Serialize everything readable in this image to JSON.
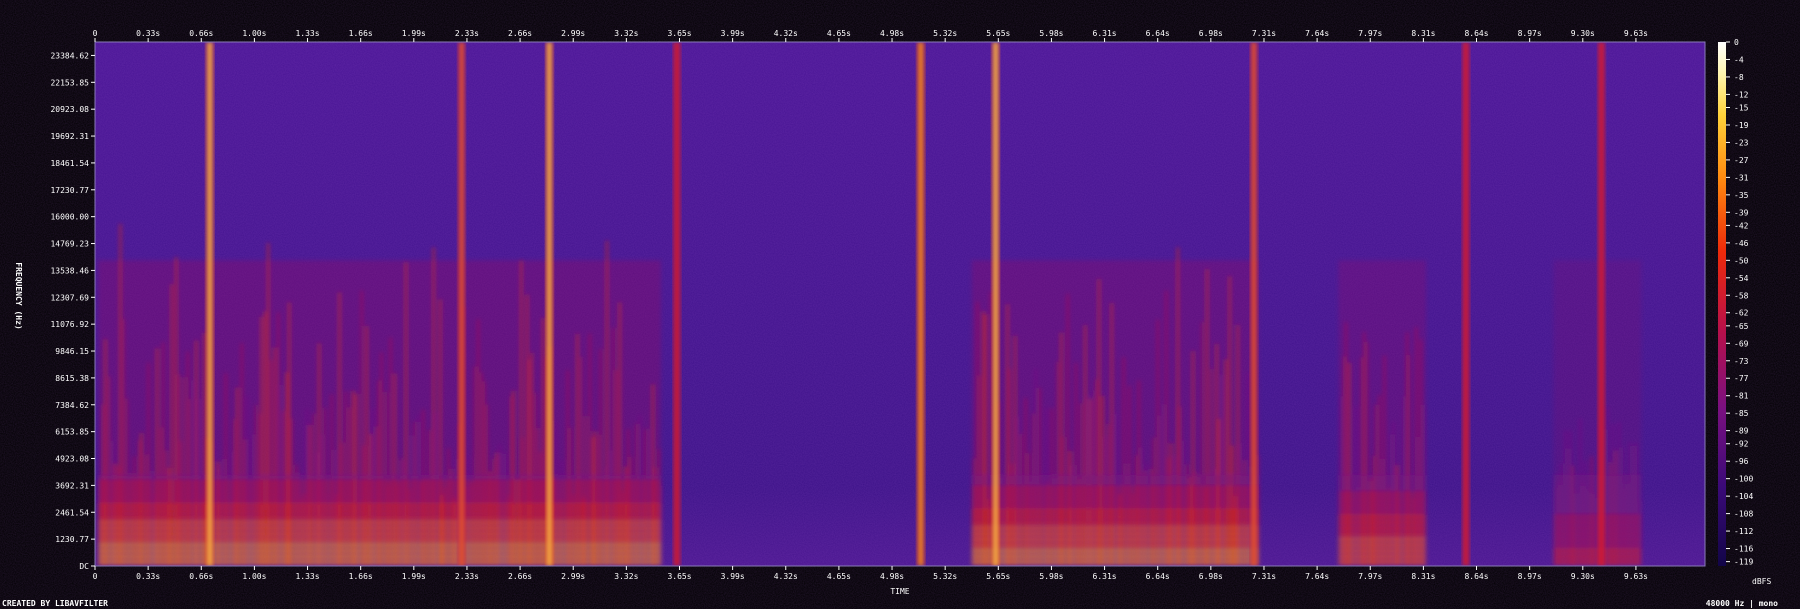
{
  "chart_data": {
    "type": "heatmap",
    "xlabel": "TIME",
    "ylabel": "FREQUENCY (Hz)",
    "x_ticks": [
      "0",
      "0.33s",
      "0.66s",
      "1.00s",
      "1.33s",
      "1.66s",
      "1.99s",
      "2.33s",
      "2.66s",
      "2.99s",
      "3.32s",
      "3.65s",
      "3.99s",
      "4.32s",
      "4.65s",
      "4.98s",
      "5.32s",
      "5.65s",
      "5.98s",
      "6.31s",
      "6.64s",
      "6.98s",
      "7.31s",
      "7.64s",
      "7.97s",
      "8.31s",
      "8.64s",
      "8.97s",
      "9.30s",
      "9.63s"
    ],
    "y_ticks": [
      "23384.62",
      "22153.85",
      "20923.08",
      "19692.31",
      "18461.54",
      "17230.77",
      "16000.00",
      "14769.23",
      "13538.46",
      "12307.69",
      "11076.92",
      "9846.15",
      "8615.38",
      "7384.62",
      "6153.85",
      "4923.08",
      "3692.31",
      "2461.54",
      "1230.77",
      "DC"
    ],
    "colorbar_ticks": [
      "0",
      "-4",
      "-8",
      "-12",
      "-15",
      "-19",
      "-23",
      "-27",
      "-31",
      "-35",
      "-39",
      "-42",
      "-46",
      "-50",
      "-54",
      "-58",
      "-62",
      "-65",
      "-69",
      "-73",
      "-77",
      "-81",
      "-85",
      "-89",
      "-92",
      "-96",
      "-100",
      "-104",
      "-108",
      "-112",
      "-116",
      "-119"
    ],
    "colorbar_unit": "dBFS",
    "xlim": [
      0,
      10.1
    ],
    "ylim": [
      0,
      24000
    ],
    "clim": [
      -120,
      0
    ],
    "speech_segments": [
      {
        "t0": 0.02,
        "t1": 3.55,
        "level": 0.85
      },
      {
        "t0": 5.5,
        "t1": 7.3,
        "level": 0.8
      },
      {
        "t0": 7.8,
        "t1": 8.35,
        "level": 0.7
      },
      {
        "t0": 9.15,
        "t1": 9.7,
        "level": 0.45
      }
    ],
    "transients": [
      {
        "t": 0.72,
        "level": 0.95
      },
      {
        "t": 2.3,
        "level": 0.7
      },
      {
        "t": 2.85,
        "level": 0.9
      },
      {
        "t": 3.65,
        "level": 0.5
      },
      {
        "t": 5.18,
        "level": 0.75
      },
      {
        "t": 5.65,
        "level": 0.9
      },
      {
        "t": 7.27,
        "level": 0.7
      },
      {
        "t": 8.6,
        "level": 0.55
      },
      {
        "t": 9.45,
        "level": 0.5
      }
    ]
  },
  "footer": {
    "credit": "CREATED BY LIBAVFILTER",
    "info": "48000 Hz | mono"
  }
}
